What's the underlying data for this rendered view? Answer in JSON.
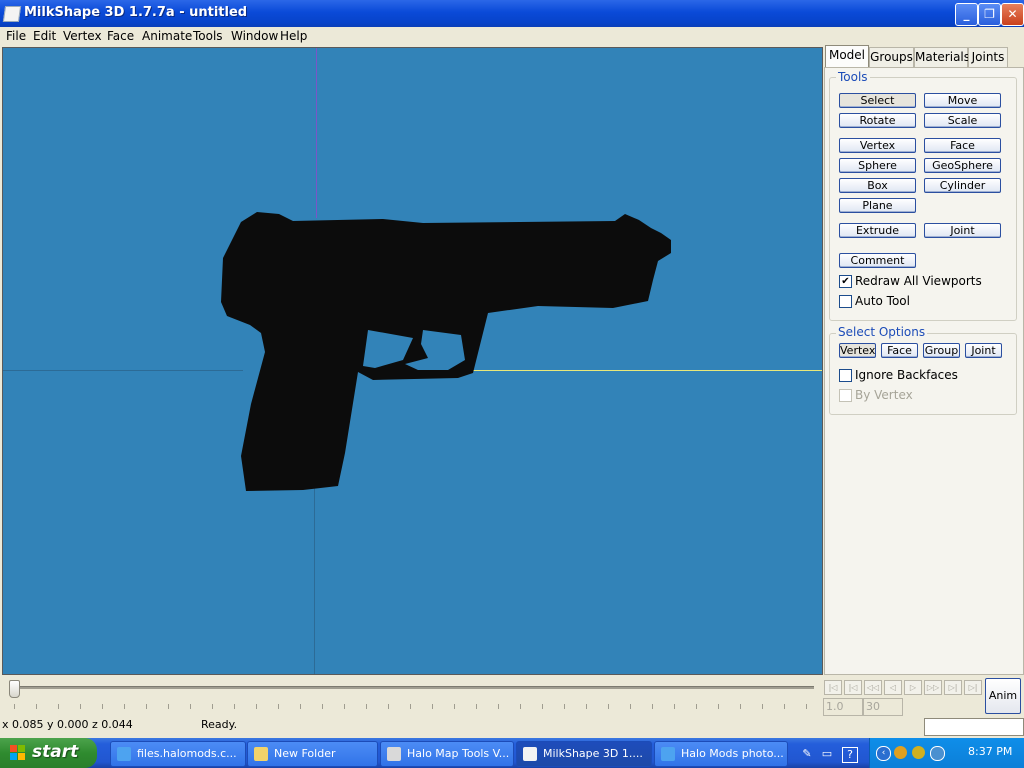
{
  "window": {
    "title": "MilkShape 3D 1.7.7a - untitled",
    "minimize": "_",
    "maximize": "❐",
    "close": "✕"
  },
  "menu": [
    "File",
    "Edit",
    "Vertex",
    "Face",
    "Animate",
    "Tools",
    "Window",
    "Help"
  ],
  "tabs": [
    "Model",
    "Groups",
    "Materials",
    "Joints"
  ],
  "active_tab": "Model",
  "tools": {
    "label": "Tools",
    "buttons": [
      "Select",
      "Move",
      "Rotate",
      "Scale",
      "Vertex",
      "Face",
      "Sphere",
      "GeoSphere",
      "Box",
      "Cylinder",
      "Plane",
      "Extrude",
      "Joint",
      "Comment"
    ],
    "redraw_all_viewports": {
      "label": "Redraw All Viewports",
      "checked": true
    },
    "auto_tool": {
      "label": "Auto Tool",
      "checked": false
    }
  },
  "select_options": {
    "label": "Select Options",
    "buttons": [
      "Vertex",
      "Face",
      "Group",
      "Joint"
    ],
    "ignore_backfaces": {
      "label": "Ignore Backfaces",
      "checked": false
    },
    "by_vertex": {
      "label": "By Vertex",
      "checked": false,
      "disabled": true
    }
  },
  "animation": {
    "frame_start": "1.0",
    "frame_end": "30",
    "anim_button": "Anim",
    "nav_buttons": [
      "|◁",
      "|◁",
      "◁◁",
      "◁",
      "▷",
      "▷▷",
      "▷|",
      "▷|"
    ]
  },
  "status": {
    "coords": "x 0.085 y 0.000 z 0.044",
    "message": "Ready."
  },
  "taskbar": {
    "start": "start",
    "items": [
      {
        "label": "files.halomods.c...",
        "icon": "ie-icon"
      },
      {
        "label": "New Folder",
        "icon": "folder-icon"
      },
      {
        "label": "Halo Map Tools V...",
        "icon": "app-icon"
      },
      {
        "label": "MilkShape 3D 1....",
        "icon": "milkshape-icon",
        "active": true
      },
      {
        "label": "Halo Mods photo...",
        "icon": "ie-icon"
      }
    ],
    "clock": "8:37 PM"
  }
}
